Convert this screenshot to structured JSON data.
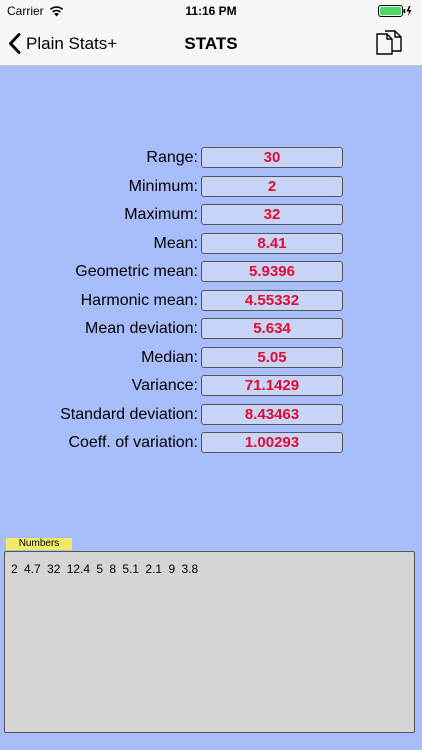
{
  "status_bar": {
    "carrier": "Carrier",
    "time": "11:16 PM"
  },
  "nav": {
    "back_label": "Plain Stats+",
    "title": "STATS"
  },
  "stats": [
    {
      "label": "Range:",
      "value": "30"
    },
    {
      "label": "Minimum:",
      "value": "2"
    },
    {
      "label": "Maximum:",
      "value": "32"
    },
    {
      "label": "Mean:",
      "value": "8.41"
    },
    {
      "label": "Geometric mean:",
      "value": "5.9396"
    },
    {
      "label": "Harmonic mean:",
      "value": "4.55332"
    },
    {
      "label": "Mean deviation:",
      "value": "5.634"
    },
    {
      "label": "Median:",
      "value": "5.05"
    },
    {
      "label": "Variance:",
      "value": "71.1429"
    },
    {
      "label": "Standard deviation:",
      "value": "8.43463"
    },
    {
      "label": "Coeff. of variation:",
      "value": "1.00293"
    }
  ],
  "numbers": {
    "tag": "Numbers",
    "value": "2  4.7  32  12.4  5  8  5.1  2.1  9  3.8"
  },
  "colors": {
    "background": "#a8bdfb",
    "value_text": "#e40b2f",
    "value_box": "#c9d4f9",
    "numbers_tag": "#f0ec6a",
    "numbers_box": "#d5d5d5",
    "battery": "#4cd964"
  },
  "icons": {
    "wifi": "wifi-icon",
    "battery": "battery-icon",
    "back": "chevron-left-icon",
    "copy": "copy-documents-icon"
  }
}
